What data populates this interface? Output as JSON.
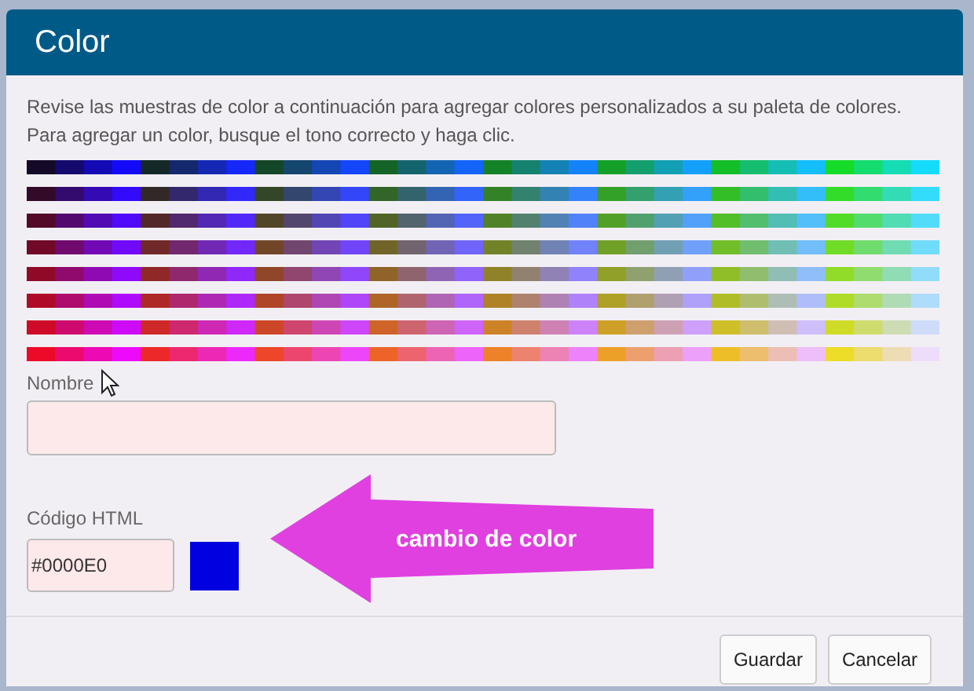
{
  "dialog": {
    "title": "Color",
    "intro": "Revise las muestras de color a continuación para agregar colores personalizados a su paleta de colores. Para agregar un color, busque el tono correcto y haga clic."
  },
  "name_field": {
    "label": "Nombre"
  },
  "html_code": {
    "label": "Código HTML",
    "value": "#0000E0"
  },
  "annotation": {
    "text": "cambio de color"
  },
  "buttons": [
    "Guardar",
    "Cancelar"
  ]
}
